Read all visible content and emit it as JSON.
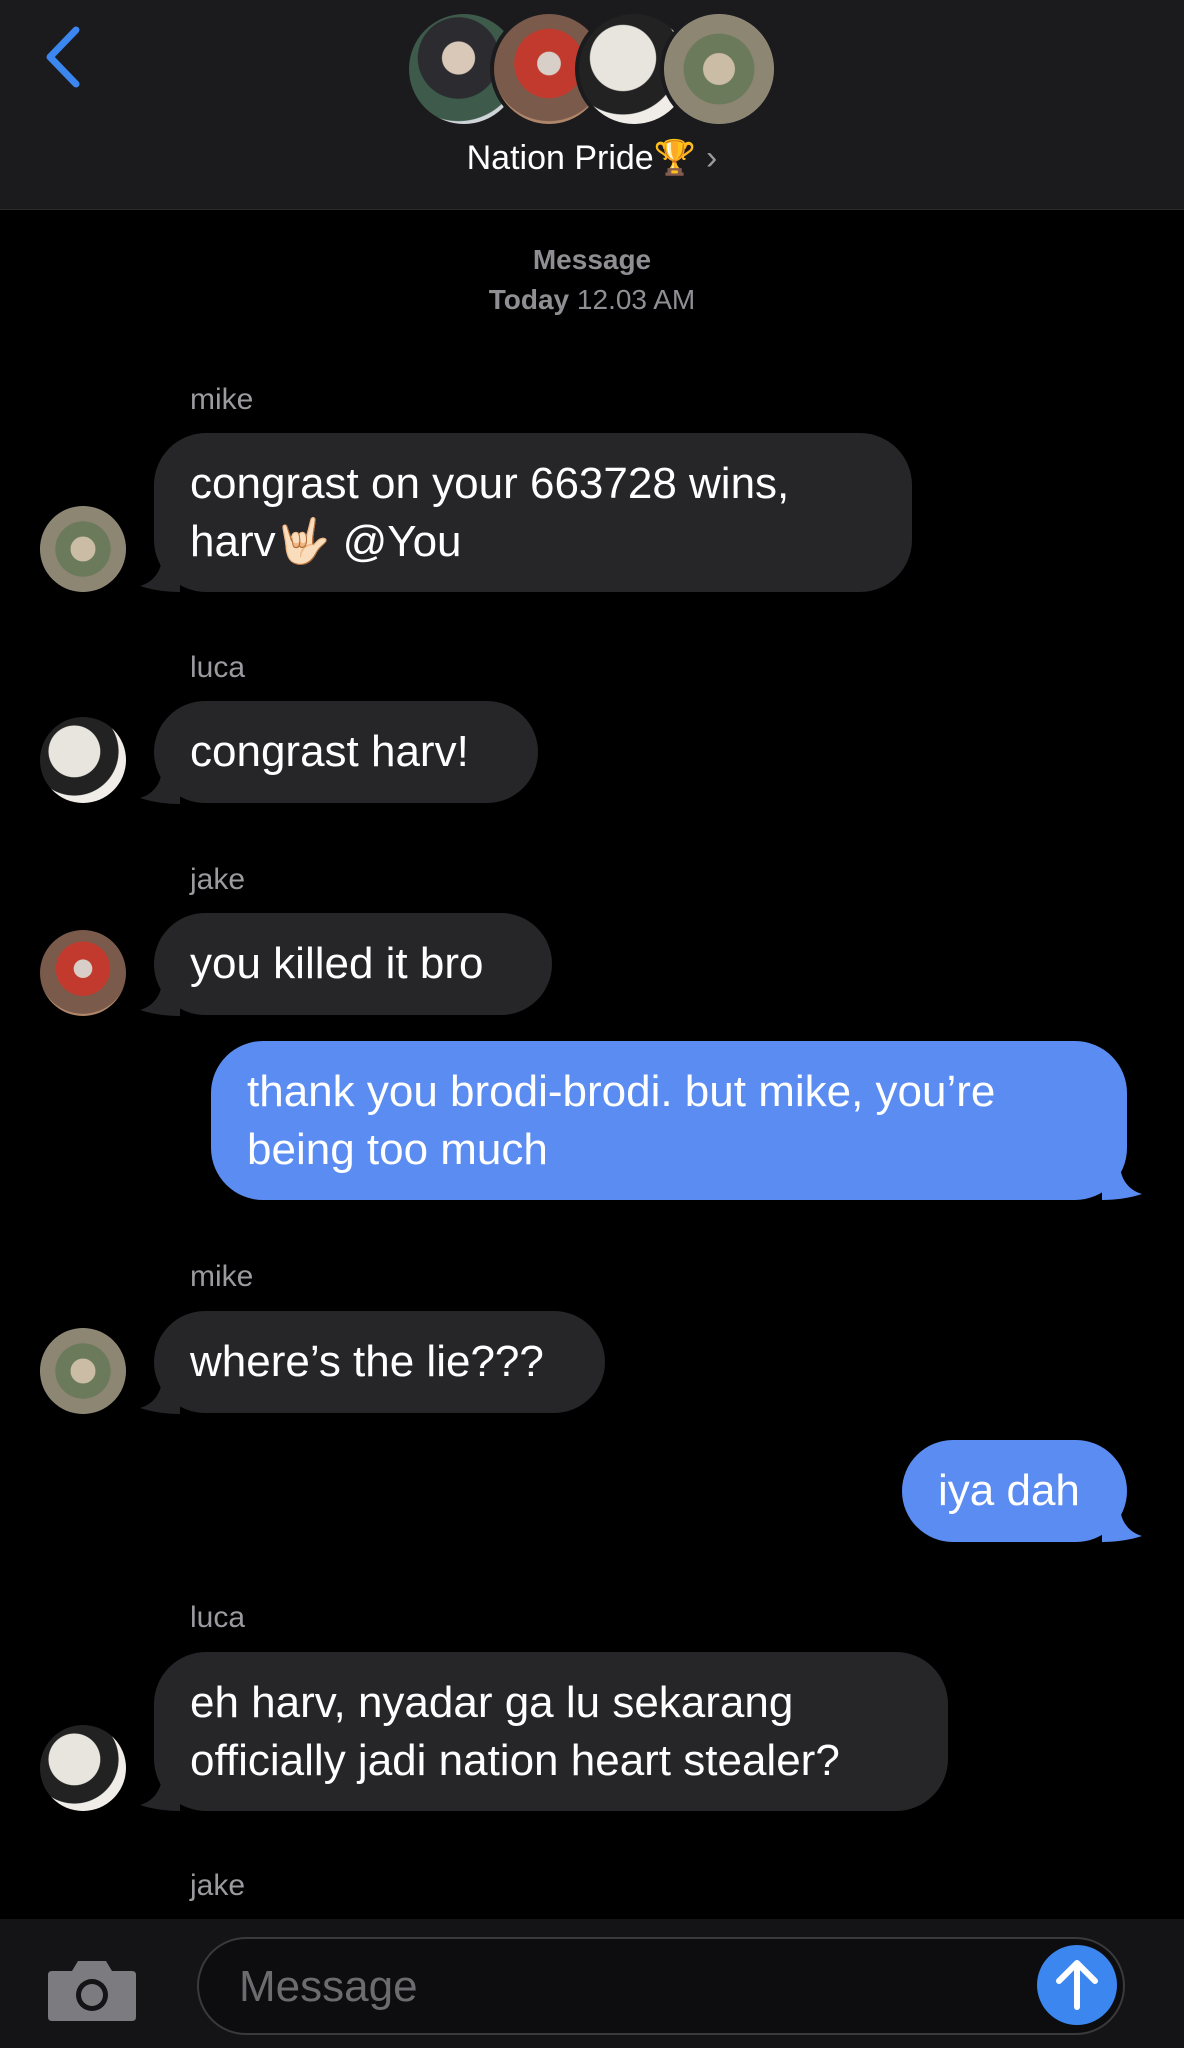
{
  "header": {
    "group_name": "Nation Pride🏆",
    "chevron": "›",
    "back_icon": "chevron-left-icon"
  },
  "timestamp": {
    "label": "Message",
    "day": "Today",
    "time": "12.03 AM"
  },
  "messages": [
    {
      "sender": "mike",
      "lines": [
        "congrast on your 663728 wins,",
        "harv🤟🏻 @You"
      ],
      "direction": "incoming"
    },
    {
      "sender": "luca",
      "lines": [
        "congrast harv!"
      ],
      "direction": "incoming"
    },
    {
      "sender": "jake",
      "lines": [
        "you killed it bro"
      ],
      "direction": "incoming"
    },
    {
      "sender": "",
      "lines": [
        "thank you brodi-brodi. but mike, you’re",
        "being too much"
      ],
      "direction": "outgoing"
    },
    {
      "sender": "mike",
      "lines": [
        "where’s the lie???"
      ],
      "direction": "incoming"
    },
    {
      "sender": "",
      "lines": [
        "iya dah"
      ],
      "direction": "outgoing"
    },
    {
      "sender": "luca",
      "lines": [
        "eh harv, nyadar ga lu sekarang",
        "officially jadi nation heart stealer?"
      ],
      "direction": "incoming"
    },
    {
      "sender": "jake",
      "lines": [],
      "direction": "incoming"
    }
  ],
  "composer": {
    "placeholder": "Message",
    "camera_icon": "camera-icon",
    "send_icon": "send-arrow-icon"
  },
  "colors": {
    "accent": "#5b8cf2",
    "incoming_bubble": "#262629",
    "header_bg": "#1b1b1d",
    "back_arrow": "#3c86f0"
  }
}
